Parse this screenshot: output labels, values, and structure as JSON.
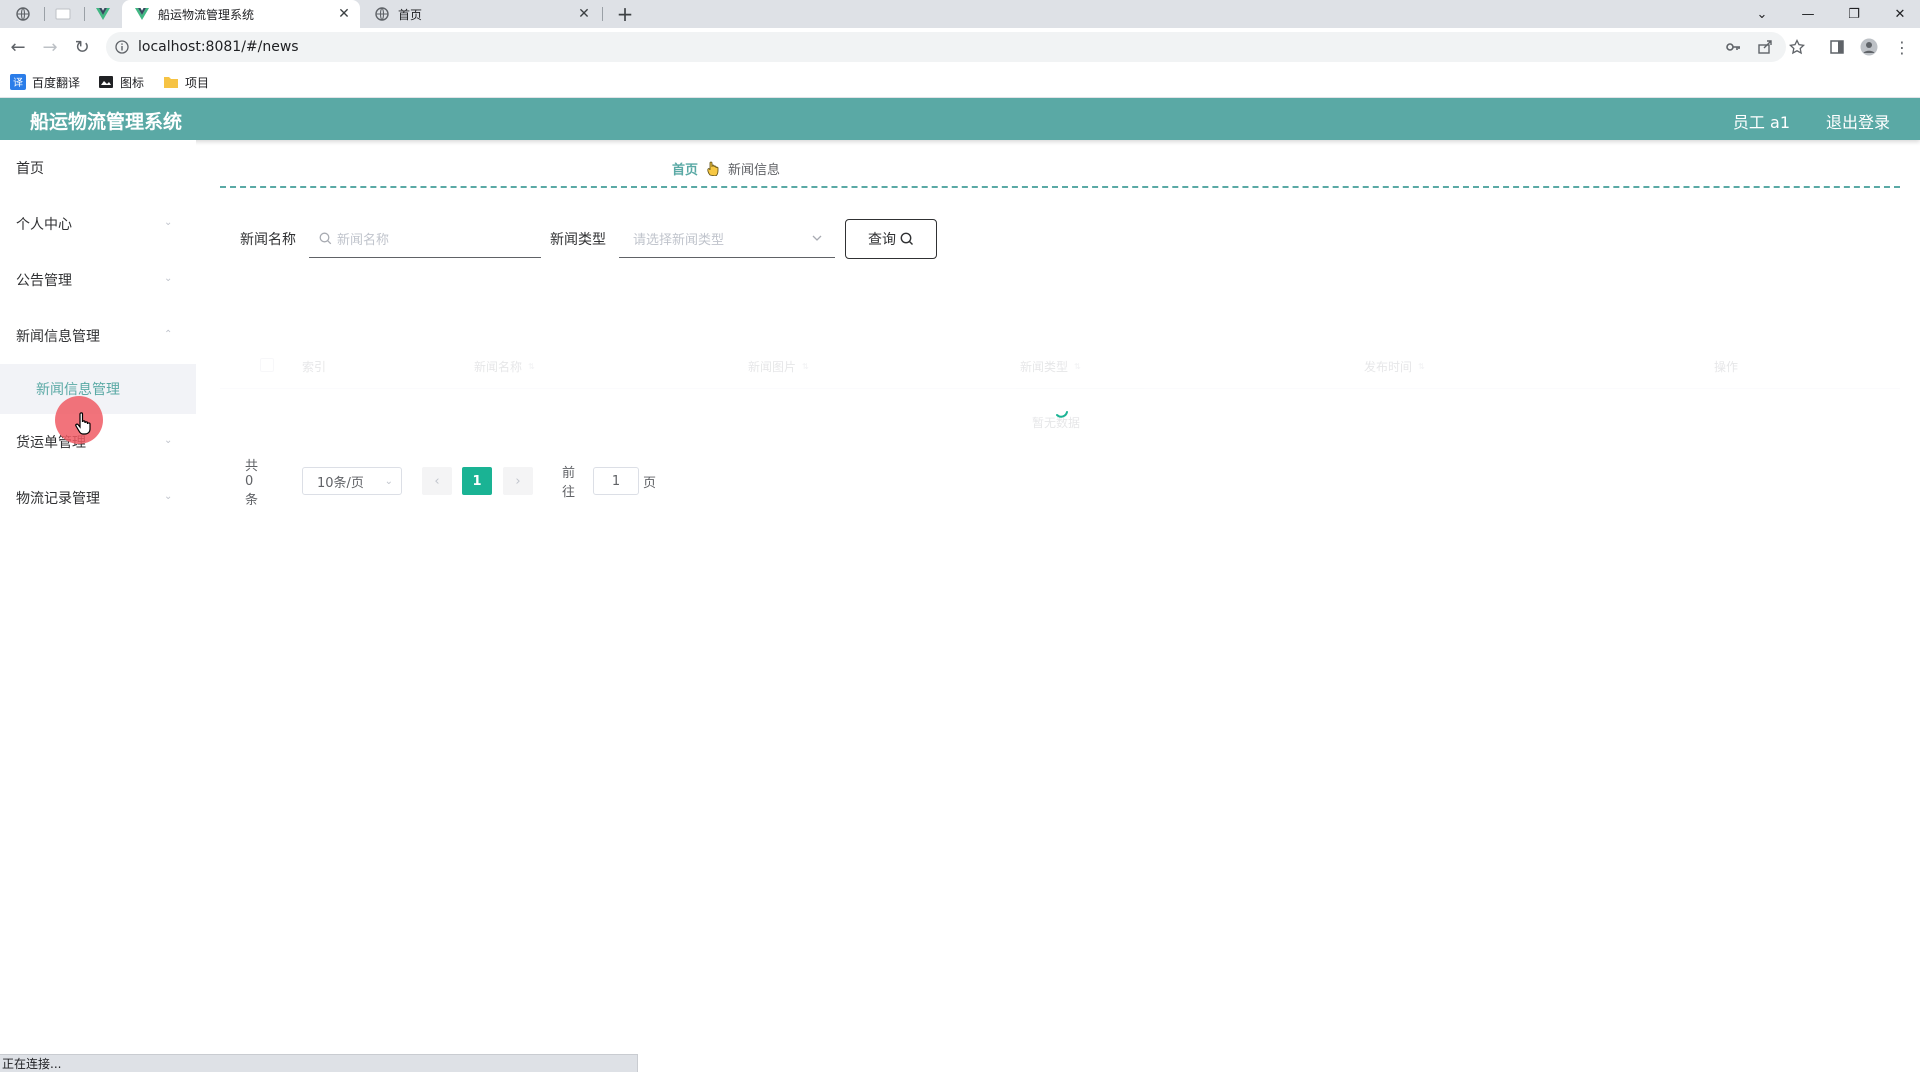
{
  "browser": {
    "tabs": [
      {
        "title": "船运物流管理系统",
        "active": true
      },
      {
        "title": "首页",
        "active": false
      }
    ],
    "url": "localhost:8081/#/news",
    "bookmarks": [
      "百度翻译",
      "图标",
      "项目"
    ],
    "status_text": "正在连接..."
  },
  "header": {
    "title": "船运物流管理系统",
    "user": "员工 a1",
    "logout": "退出登录",
    "color": "#5aa9a5"
  },
  "sidebar": {
    "items": [
      {
        "label": "首页"
      },
      {
        "label": "个人中心"
      },
      {
        "label": "公告管理"
      },
      {
        "label": "新闻信息管理"
      },
      {
        "label": "货运单管理"
      },
      {
        "label": "物流记录管理"
      }
    ],
    "subitem": "新闻信息管理"
  },
  "breadcrumb": {
    "home": "首页",
    "current": "新闻信息"
  },
  "search": {
    "name_label": "新闻名称",
    "name_placeholder": "新闻名称",
    "type_label": "新闻类型",
    "type_placeholder": "请选择新闻类型",
    "query_button": "查询"
  },
  "table": {
    "columns": [
      "索引",
      "新闻名称",
      "新闻图片",
      "新闻类型",
      "发布时间",
      "操作"
    ],
    "empty_text": "暂无数据"
  },
  "pagination": {
    "total": "共 0 条",
    "page_size": "10条/页",
    "current_page": "1",
    "goto_label": "前往",
    "goto_value": "1",
    "page_unit": "页",
    "accent": "#1ab394"
  }
}
